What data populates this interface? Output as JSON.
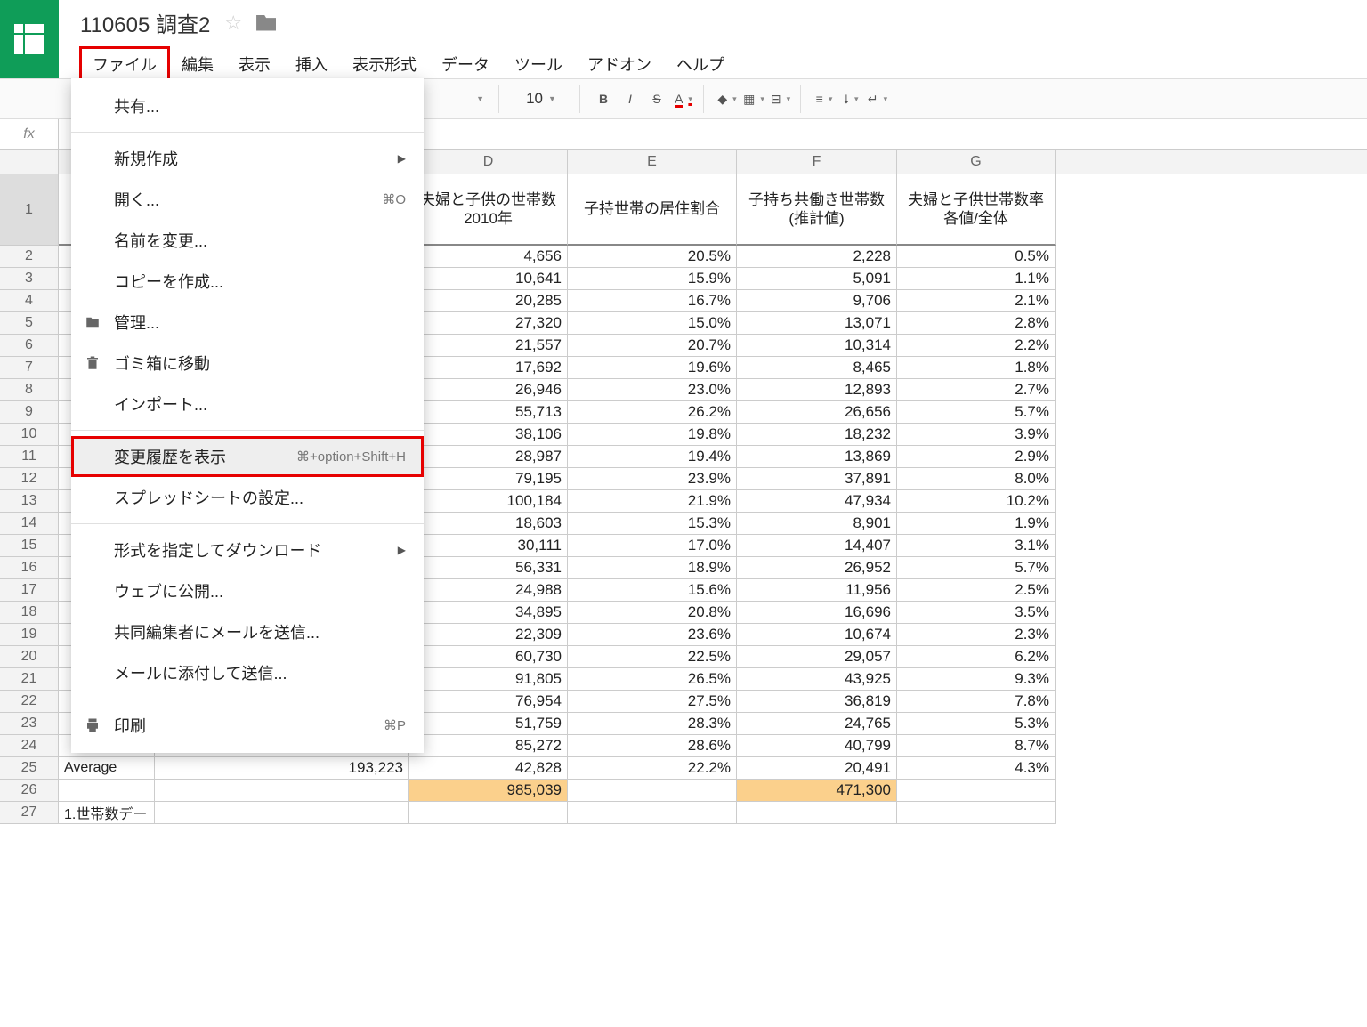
{
  "doc": {
    "title": "110605 調査2"
  },
  "menubar": [
    "ファイル",
    "編集",
    "表示",
    "挿入",
    "表示形式",
    "データ",
    "ツール",
    "アドオン",
    "ヘルプ"
  ],
  "toolbar": {
    "font": "Arial",
    "size": "10"
  },
  "columns": [
    "D",
    "E",
    "F",
    "G"
  ],
  "header_row": {
    "D": "夫婦と子供の世帯数\n2010年",
    "E": "子持世帯の居住割合",
    "F": "子持ち共働き世帯数\n(推計値)",
    "G": "夫婦と子供世帯数率\n各値/全体"
  },
  "data_rows": [
    {
      "n": 2,
      "D": "4,656",
      "E": "20.5%",
      "F": "2,228",
      "G": "0.5%"
    },
    {
      "n": 3,
      "D": "10,641",
      "E": "15.9%",
      "F": "5,091",
      "G": "1.1%"
    },
    {
      "n": 4,
      "D": "20,285",
      "E": "16.7%",
      "F": "9,706",
      "G": "2.1%"
    },
    {
      "n": 5,
      "D": "27,320",
      "E": "15.0%",
      "F": "13,071",
      "G": "2.8%"
    },
    {
      "n": 6,
      "D": "21,557",
      "E": "20.7%",
      "F": "10,314",
      "G": "2.2%"
    },
    {
      "n": 7,
      "D": "17,692",
      "E": "19.6%",
      "F": "8,465",
      "G": "1.8%"
    },
    {
      "n": 8,
      "D": "26,946",
      "E": "23.0%",
      "F": "12,893",
      "G": "2.7%"
    },
    {
      "n": 9,
      "D": "55,713",
      "E": "26.2%",
      "F": "26,656",
      "G": "5.7%"
    },
    {
      "n": 10,
      "D": "38,106",
      "E": "19.8%",
      "F": "18,232",
      "G": "3.9%"
    },
    {
      "n": 11,
      "D": "28,987",
      "E": "19.4%",
      "F": "13,869",
      "G": "2.9%"
    },
    {
      "n": 12,
      "D": "79,195",
      "E": "23.9%",
      "F": "37,891",
      "G": "8.0%"
    },
    {
      "n": 13,
      "D": "100,184",
      "E": "21.9%",
      "F": "47,934",
      "G": "10.2%"
    },
    {
      "n": 14,
      "D": "18,603",
      "E": "15.3%",
      "F": "8,901",
      "G": "1.9%"
    },
    {
      "n": 15,
      "D": "30,111",
      "E": "17.0%",
      "F": "14,407",
      "G": "3.1%"
    },
    {
      "n": 16,
      "D": "56,331",
      "E": "18.9%",
      "F": "26,952",
      "G": "5.7%"
    },
    {
      "n": 17,
      "D": "24,988",
      "E": "15.6%",
      "F": "11,956",
      "G": "2.5%"
    },
    {
      "n": 18,
      "D": "34,895",
      "E": "20.8%",
      "F": "16,696",
      "G": "3.5%"
    },
    {
      "n": 19,
      "D": "22,309",
      "E": "23.6%",
      "F": "10,674",
      "G": "2.3%"
    },
    {
      "n": 20,
      "D": "60,730",
      "E": "22.5%",
      "F": "29,057",
      "G": "6.2%"
    },
    {
      "n": 21,
      "D": "91,805",
      "E": "26.5%",
      "F": "43,925",
      "G": "9.3%"
    },
    {
      "n": 22,
      "D": "76,954",
      "E": "27.5%",
      "F": "36,819",
      "G": "7.8%"
    },
    {
      "n": 23,
      "D": "51,759",
      "E": "28.3%",
      "F": "24,765",
      "G": "5.3%"
    },
    {
      "n": 24,
      "D": "85,272",
      "E": "28.6%",
      "F": "40,799",
      "G": "8.7%"
    }
  ],
  "avg_row": {
    "n": 25,
    "A": "Average",
    "C": "193,223",
    "D": "42,828",
    "E": "22.2%",
    "F": "20,491",
    "G": "4.3%"
  },
  "sum_row": {
    "n": 26,
    "D": "985,039",
    "F": "471,300"
  },
  "row27": {
    "n": 27,
    "A": "1.世帯数デー"
  },
  "file_menu": [
    {
      "type": "item",
      "label": "共有..."
    },
    {
      "type": "sep"
    },
    {
      "type": "item",
      "label": "新規作成",
      "arrow": true
    },
    {
      "type": "item",
      "label": "開く...",
      "shortcut": "⌘O"
    },
    {
      "type": "item",
      "label": "名前を変更..."
    },
    {
      "type": "item",
      "label": "コピーを作成..."
    },
    {
      "type": "item",
      "label": "管理...",
      "icon": "folder"
    },
    {
      "type": "item",
      "label": "ゴミ箱に移動",
      "icon": "trash"
    },
    {
      "type": "item",
      "label": "インポート..."
    },
    {
      "type": "sep"
    },
    {
      "type": "item",
      "label": "変更履歴を表示",
      "shortcut": "⌘+option+Shift+H",
      "highlight": true
    },
    {
      "type": "item",
      "label": "スプレッドシートの設定..."
    },
    {
      "type": "sep"
    },
    {
      "type": "item",
      "label": "形式を指定してダウンロード",
      "arrow": true
    },
    {
      "type": "item",
      "label": "ウェブに公開..."
    },
    {
      "type": "item",
      "label": "共同編集者にメールを送信..."
    },
    {
      "type": "item",
      "label": "メールに添付して送信..."
    },
    {
      "type": "sep"
    },
    {
      "type": "item",
      "label": "印刷",
      "shortcut": "⌘P",
      "icon": "print"
    }
  ]
}
